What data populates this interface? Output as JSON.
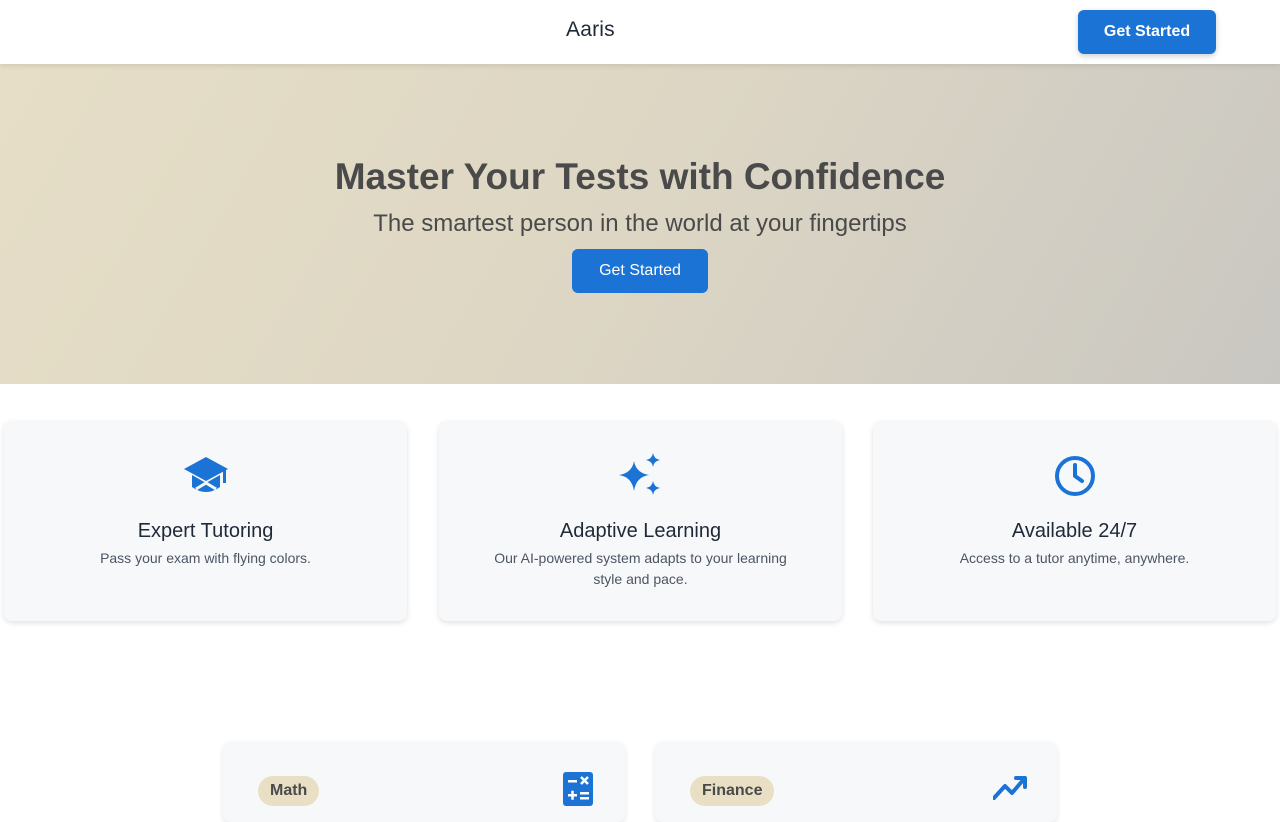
{
  "header": {
    "brand": "Aaris",
    "cta_label": "Get Started"
  },
  "hero": {
    "title": "Master Your Tests with Confidence",
    "subtitle": "The smartest person in the world at your fingertips",
    "cta_label": "Get Started"
  },
  "features": [
    {
      "icon": "graduation-cap-icon",
      "title": "Expert Tutoring",
      "description": "Pass your exam with flying colors."
    },
    {
      "icon": "sparkles-icon",
      "title": "Adaptive Learning",
      "description": "Our AI-powered system adapts to your learning style and pace."
    },
    {
      "icon": "clock-icon",
      "title": "Available 24/7",
      "description": "Access to a tutor anytime, anywhere."
    }
  ],
  "subjects": [
    {
      "tag": "Math",
      "icon": "calculator-icon"
    },
    {
      "tag": "Finance",
      "icon": "trending-up-icon"
    }
  ],
  "colors": {
    "accent": "#1b73d6",
    "icon_blue": "#1b73d6",
    "tag_bg": "#e8dfc5"
  }
}
